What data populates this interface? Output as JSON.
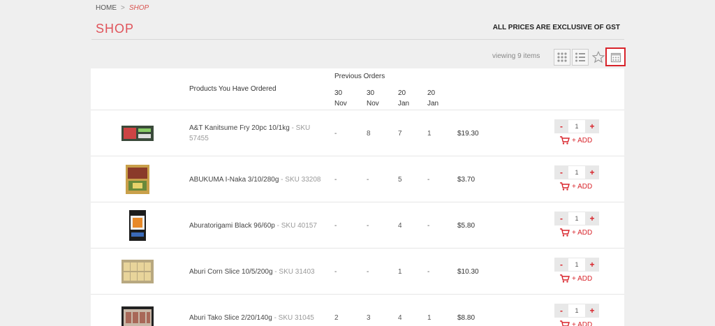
{
  "breadcrumb": {
    "home": "HOME",
    "separator": ">",
    "current": "SHOP"
  },
  "page_title": "SHOP",
  "gst_note": "ALL PRICES ARE EXCLUSIVE OF GST",
  "viewing_text": "viewing 9 items",
  "view_modes": [
    "grid-view",
    "list-view",
    "favourites-view",
    "previous-orders-view"
  ],
  "active_view": "previous-orders-view",
  "table": {
    "products_header": "Products You Have Ordered",
    "previous_header": "Previous Orders",
    "dates": [
      {
        "day": "30",
        "month": "Nov"
      },
      {
        "day": "30",
        "month": "Nov"
      },
      {
        "day": "20",
        "month": "Jan"
      },
      {
        "day": "20",
        "month": "Jan"
      }
    ],
    "add_label": "+ ADD",
    "minus_label": "-",
    "plus_label": "+",
    "rows": [
      {
        "name": "A&T Kanitsume Fry 20pc 10/1kg",
        "sku": " - SKU 57455",
        "orders": [
          "-",
          "8",
          "7",
          "1"
        ],
        "price": "$19.30",
        "qty": "1"
      },
      {
        "name": "ABUKUMA I-Naka 3/10/280g",
        "sku": " - SKU 33208",
        "orders": [
          "-",
          "-",
          "5",
          "-"
        ],
        "price": "$3.70",
        "qty": "1"
      },
      {
        "name": "Aburatorigami Black 96/60p",
        "sku": " - SKU 40157",
        "orders": [
          "-",
          "-",
          "4",
          "-"
        ],
        "price": "$5.80",
        "qty": "1"
      },
      {
        "name": "Aburi Corn Slice 10/5/200g",
        "sku": " - SKU 31403",
        "orders": [
          "-",
          "-",
          "1",
          "-"
        ],
        "price": "$10.30",
        "qty": "1"
      },
      {
        "name": "Aburi Tako Slice 2/20/140g",
        "sku": " - SKU 31045",
        "orders": [
          "2",
          "3",
          "4",
          "1"
        ],
        "price": "$8.80",
        "qty": "1"
      }
    ]
  },
  "colors": {
    "accent": "#d8232a",
    "title": "#e0535a",
    "background": "#efefef"
  }
}
